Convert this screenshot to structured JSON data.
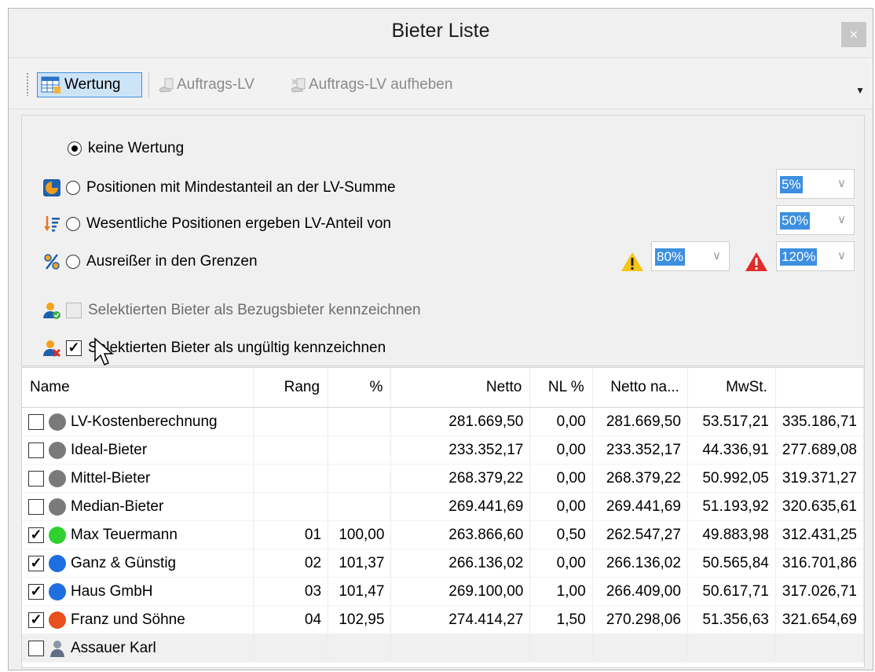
{
  "window": {
    "title": "Bieter Liste",
    "close_glyph": "×"
  },
  "toolbar": {
    "wertung_label": "Wertung",
    "auftrags_lv_label": "Auftrags-LV",
    "auftrags_lv_aufheben_label": "Auftrags-LV aufheben",
    "overflow_glyph": "▼"
  },
  "options": {
    "keine_wertung": {
      "label": "keine Wertung",
      "selected": true
    },
    "mindestanteil": {
      "label": "Positionen mit Mindestanteil an der LV-Summe",
      "value": "5%"
    },
    "wesentliche": {
      "label": "Wesentliche Positionen ergeben LV-Anteil von",
      "value": "50%"
    },
    "ausreisser": {
      "label": "Ausreißer in den Grenzen",
      "low_value": "80%",
      "high_value": "120%"
    },
    "bezugsbieter": {
      "label": "Selektierten Bieter als Bezugsbieter kennzeichnen",
      "checked": false,
      "enabled": false
    },
    "ungueltig": {
      "label": "Selektierten Bieter als ungültig kennzeichnen",
      "checked": true
    }
  },
  "colors": {
    "gray": "#7a7a7a",
    "green": "#2fd02f",
    "blue": "#1e6fe0",
    "orange": "#e8501e",
    "selection": "#3d8fe0"
  },
  "grid": {
    "headers": [
      "Name",
      "Rang",
      "%",
      "Netto",
      "NL %",
      "Netto na...",
      "MwSt.",
      ""
    ],
    "rows": [
      {
        "checked": false,
        "marker": "gray",
        "name": "LV-Kostenberechnung",
        "rang": "",
        "pct": "",
        "netto": "281.669,50",
        "nl": "0,00",
        "netto_na": "281.669,50",
        "mwst": "53.517,21",
        "brutto": "335.186,71"
      },
      {
        "checked": false,
        "marker": "gray",
        "name": "Ideal-Bieter",
        "rang": "",
        "pct": "",
        "netto": "233.352,17",
        "nl": "0,00",
        "netto_na": "233.352,17",
        "mwst": "44.336,91",
        "brutto": "277.689,08"
      },
      {
        "checked": false,
        "marker": "gray",
        "name": "Mittel-Bieter",
        "rang": "",
        "pct": "",
        "netto": "268.379,22",
        "nl": "0,00",
        "netto_na": "268.379,22",
        "mwst": "50.992,05",
        "brutto": "319.371,27"
      },
      {
        "checked": false,
        "marker": "gray",
        "name": "Median-Bieter",
        "rang": "",
        "pct": "",
        "netto": "269.441,69",
        "nl": "0,00",
        "netto_na": "269.441,69",
        "mwst": "51.193,92",
        "brutto": "320.635,61"
      },
      {
        "checked": true,
        "marker": "green",
        "name": "Max Teuermann",
        "rang": "01",
        "pct": "100,00",
        "netto": "263.866,60",
        "nl": "0,50",
        "netto_na": "262.547,27",
        "mwst": "49.883,98",
        "brutto": "312.431,25"
      },
      {
        "checked": true,
        "marker": "blue",
        "name": "Ganz & Günstig",
        "rang": "02",
        "pct": "101,37",
        "netto": "266.136,02",
        "nl": "0,00",
        "netto_na": "266.136,02",
        "mwst": "50.565,84",
        "brutto": "316.701,86"
      },
      {
        "checked": true,
        "marker": "blue",
        "name": "Haus GmbH",
        "rang": "03",
        "pct": "101,47",
        "netto": "269.100,00",
        "nl": "1,00",
        "netto_na": "266.409,00",
        "mwst": "50.617,71",
        "brutto": "317.026,71"
      },
      {
        "checked": true,
        "marker": "orange",
        "name": "Franz und Söhne",
        "rang": "04",
        "pct": "102,95",
        "netto": "274.414,27",
        "nl": "1,50",
        "netto_na": "270.298,06",
        "mwst": "51.356,63",
        "brutto": "321.654,69"
      },
      {
        "checked": false,
        "marker": "person",
        "name": "Assauer Karl",
        "rang": "",
        "pct": "",
        "netto": "",
        "nl": "",
        "netto_na": "",
        "mwst": "",
        "brutto": ""
      }
    ]
  }
}
